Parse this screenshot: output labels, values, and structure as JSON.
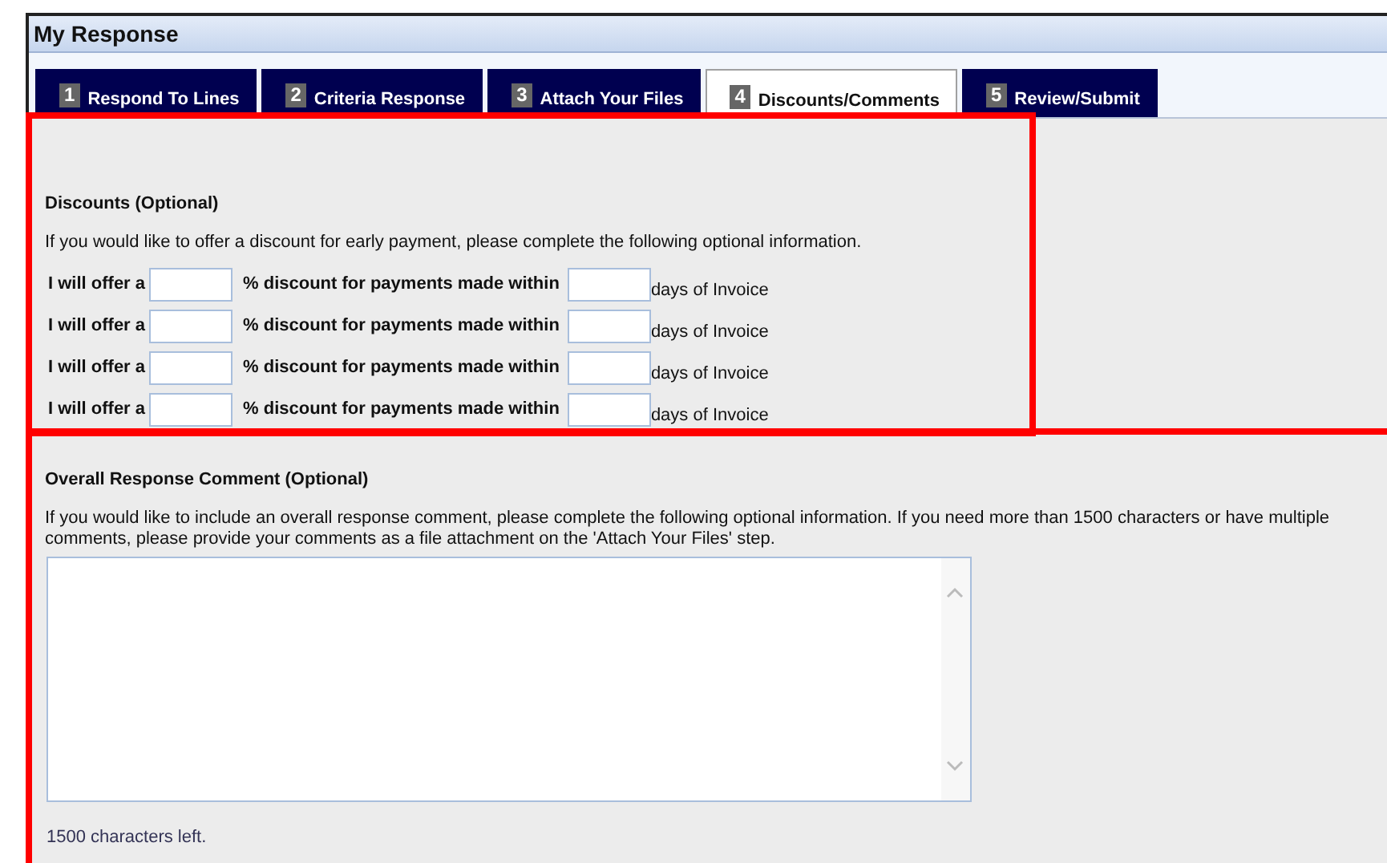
{
  "window": {
    "title": "My Response"
  },
  "tabs": [
    {
      "number": "1",
      "label": "Respond To Lines",
      "selected": false
    },
    {
      "number": "2",
      "label": "Criteria Response",
      "selected": false
    },
    {
      "number": "3",
      "label": "Attach Your Files",
      "selected": false
    },
    {
      "number": "4",
      "label": "Discounts/Comments",
      "selected": true
    },
    {
      "number": "5",
      "label": "Review/Submit",
      "selected": false
    }
  ],
  "discounts": {
    "highlighted": true,
    "heading": "Discounts (Optional)",
    "intro": "If you would like to offer a discount for early payment, please complete the following optional information.",
    "rows": [
      {
        "lead": "I will offer a",
        "middle": "% discount for payments made within",
        "trail": "days of Invoice"
      },
      {
        "lead": "I will offer a",
        "middle": "% discount for payments made within",
        "trail": "days of Invoice"
      },
      {
        "lead": "I will offer a",
        "middle": "% discount for payments made within",
        "trail": "days of Invoice"
      },
      {
        "lead": "I will offer a",
        "middle": "% discount for payments made within",
        "trail": "days of Invoice"
      }
    ]
  },
  "comment": {
    "highlighted": true,
    "heading": "Overall Response Comment (Optional)",
    "intro": "If you would like to include an overall response comment, please complete the following optional information. If you need more than 1500 characters or have multiple comments, please provide your comments as a file attachment on the 'Attach Your Files' step.",
    "remaining": "1500 characters left."
  }
}
